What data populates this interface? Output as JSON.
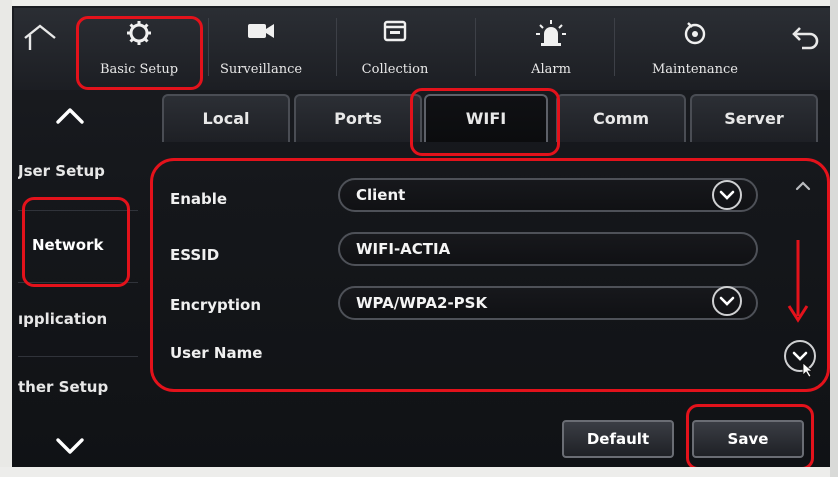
{
  "top_nav": {
    "items": [
      {
        "label": "Basic Setup",
        "icon": "gear-icon"
      },
      {
        "label": "Surveillance",
        "icon": "camera-icon"
      },
      {
        "label": "Collection",
        "icon": "folder-icon"
      },
      {
        "label": "Alarm",
        "icon": "alarm-light-icon"
      },
      {
        "label": "Maintenance",
        "icon": "maintenance-icon"
      }
    ],
    "home_icon": "home-icon",
    "back_icon": "back-arrow-icon"
  },
  "tabs": [
    {
      "label": "Local"
    },
    {
      "label": "Ports"
    },
    {
      "label": "WIFI"
    },
    {
      "label": "Comm"
    },
    {
      "label": "Server"
    }
  ],
  "active_tab": "WIFI",
  "sidebar": {
    "items": [
      {
        "label": "Jser Setup"
      },
      {
        "label": "Network"
      },
      {
        "label": "ıpplication"
      },
      {
        "label": "ther Setup"
      }
    ],
    "active": "Network"
  },
  "form": {
    "enable_label": "Enable",
    "enable_value": "Client",
    "essid_label": "ESSID",
    "essid_value": "WIFI-ACTIA",
    "encryption_label": "Encryption",
    "encryption_value": "WPA/WPA2-PSK",
    "username_label": "User Name"
  },
  "buttons": {
    "default_label": "Default",
    "save_label": "Save"
  },
  "colors": {
    "annotation": "#e3121b",
    "screen_bg": "#15171b"
  }
}
